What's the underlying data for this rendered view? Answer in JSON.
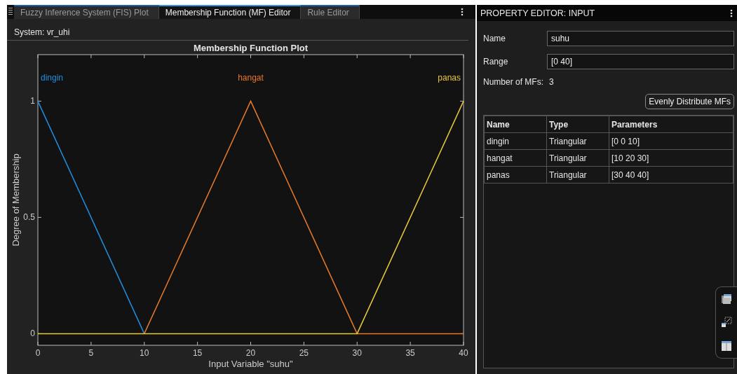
{
  "tabs": [
    {
      "label": "Fuzzy Inference System (FIS) Plot",
      "selected": false
    },
    {
      "label": "Membership Function (MF) Editor",
      "selected": true
    },
    {
      "label": "Rule Editor",
      "selected": false
    }
  ],
  "system_label": "System: vr_uhi",
  "chart": {
    "chart_data": {
      "type": "line",
      "title": "Membership Function Plot",
      "xlabel": "Input Variable \"suhu\"",
      "ylabel": "Degree of Membership",
      "x": [
        0,
        10,
        20,
        30,
        40
      ],
      "series": [
        {
          "name": "dingin",
          "color": "#1f8fe0",
          "values": [
            1,
            0,
            null,
            null,
            null
          ]
        },
        {
          "name": "hangat",
          "color": "#e8792a",
          "values": [
            null,
            0,
            1,
            0,
            0
          ]
        },
        {
          "name": "panas",
          "color": "#e8c93a",
          "values": [
            0,
            0,
            0,
            0,
            1
          ]
        }
      ],
      "xlim": [
        0,
        40
      ],
      "ylim": [
        -0.05,
        1.2
      ],
      "xticks": [
        0,
        5,
        10,
        15,
        20,
        25,
        30,
        35,
        40
      ],
      "yticks": [
        0,
        0.5,
        1
      ]
    }
  },
  "property_editor": {
    "title": "PROPERTY EDITOR: INPUT",
    "fields": [
      {
        "label": "Name",
        "value": "suhu"
      },
      {
        "label": "Range",
        "value": "[0 40]"
      }
    ],
    "mf_count_label": "Number of MFs:",
    "mf_count": "3",
    "distribute_button": "Evenly Distribute MFs",
    "table": {
      "columns": [
        "Name",
        "Type",
        "Parameters"
      ],
      "rows": [
        [
          "dingin",
          "Triangular",
          "[0 0 10]"
        ],
        [
          "hangat",
          "Triangular",
          "[10 20 30]"
        ],
        [
          "panas",
          "Triangular",
          "[30 40 40]"
        ]
      ]
    }
  }
}
